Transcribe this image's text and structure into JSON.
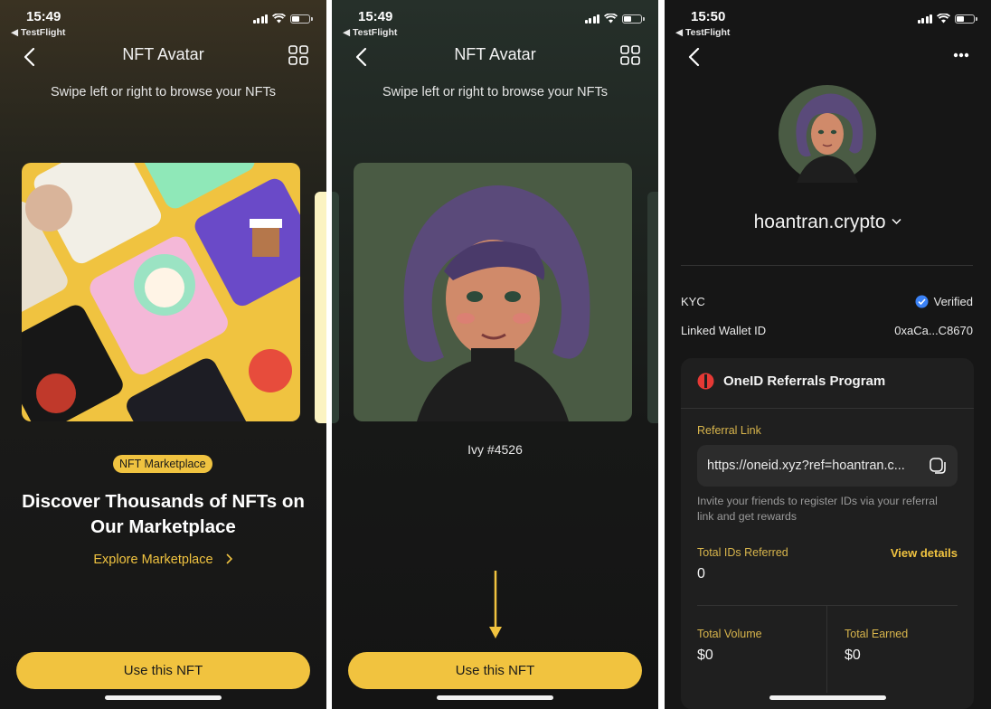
{
  "screen1": {
    "status": {
      "time": "15:49",
      "back_app": "◀ TestFlight"
    },
    "nav": {
      "title": "NFT Avatar"
    },
    "hint": "Swipe left or right to browse your NFTs",
    "badge": "NFT Marketplace",
    "headline_line1": "Discover Thousands of NFTs on",
    "headline_line2": "Our Marketplace",
    "explore": "Explore Marketplace",
    "cta": "Use this NFT"
  },
  "screen2": {
    "status": {
      "time": "15:49",
      "back_app": "◀ TestFlight"
    },
    "nav": {
      "title": "NFT Avatar"
    },
    "hint": "Swipe left or right to browse your NFTs",
    "nft_name": "Ivy #4526",
    "cta": "Use this NFT"
  },
  "screen3": {
    "status": {
      "time": "15:50",
      "back_app": "◀ TestFlight"
    },
    "username": "hoantran.crypto",
    "kyc_label": "KYC",
    "kyc_value": "Verified",
    "wallet_label": "Linked Wallet ID",
    "wallet_value": "0xaCa...C8670",
    "program_title": "OneID Referrals Program",
    "referral_label": "Referral Link",
    "referral_url": "https://oneid.xyz?ref=hoantran.c...",
    "invite_text_line1": "Invite your friends to register IDs via your referral",
    "invite_text_line2": "link and get rewards",
    "total_ids_label": "Total IDs Referred",
    "total_ids_value": "0",
    "view_details": "View details",
    "total_volume_label": "Total Volume",
    "total_volume_value": "$0",
    "total_earned_label": "Total Earned",
    "total_earned_value": "$0"
  },
  "colors": {
    "accent": "#f1c33f",
    "verified": "#3b82f6",
    "brand_red": "#e53935"
  },
  "icons": [
    "chevron-left-icon",
    "grid-icon",
    "chevron-right-icon",
    "more-icon",
    "verified-icon",
    "copy-icon",
    "oneid-logo-icon",
    "chevron-down-icon",
    "arrow-down-icon"
  ]
}
